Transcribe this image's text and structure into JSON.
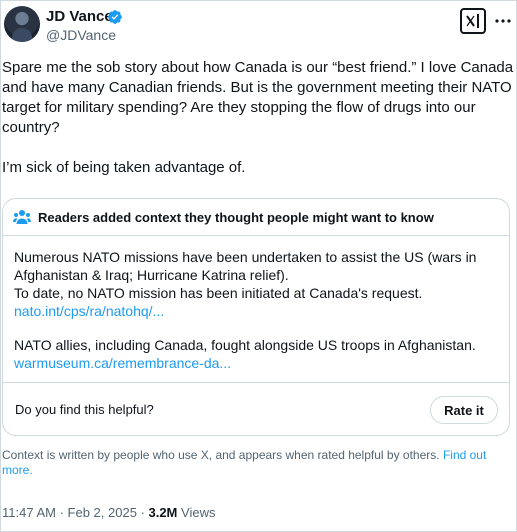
{
  "author": {
    "name": "JD Vance",
    "handle": "@JDVance",
    "verified_color": "#1d9bf0"
  },
  "icons": [
    "verified-badge-icon",
    "grok-icon",
    "more-icon",
    "people-icon"
  ],
  "tweet": {
    "text": "Spare me the sob story about how Canada is our “best friend.” I love Canada and have many Canadian friends. But is the government meeting their NATO target for military spending? Are they stopping the flow of drugs into our country?\n\nI’m sick of being taken advantage of."
  },
  "community_note": {
    "header": "Readers added context they thought people might want to know",
    "line1": "Numerous NATO missions have been undertaken to assist the US (wars in Afghanistan & Iraq; Hurricane Katrina relief).",
    "line2": "To date, no NATO mission has been initiated at Canada's request.",
    "link1": "nato.int/cps/ra/natohq/...",
    "line3": "NATO allies, including Canada, fought alongside US troops in Afghanistan.",
    "link2": "warmuseum.ca/remembrance-da...",
    "helpful_question": "Do you find this helpful?",
    "rate_label": "Rate it"
  },
  "context_info": {
    "text": "Context is written by people who use X, and appears when rated helpful by others.",
    "link": "Find out more."
  },
  "meta": {
    "time": "11:47 AM",
    "separator": " · ",
    "date": "Feb 2, 2025",
    "views_count": "3.2M",
    "views_label": "Views"
  },
  "colors": {
    "link": "#1d9bf0",
    "secondary_text": "#536471",
    "border": "#cfd9de"
  }
}
